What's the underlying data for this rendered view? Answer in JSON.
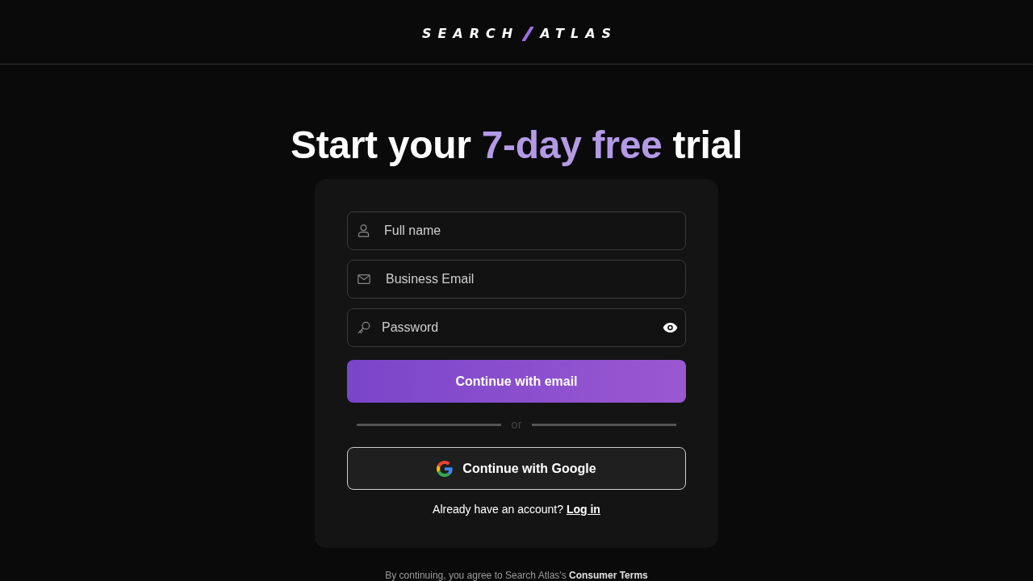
{
  "header": {
    "logo": {
      "left": "SEARCH",
      "right": "ATLAS"
    }
  },
  "heading": {
    "before": "Start your ",
    "highlight": "7-day free",
    "after": " trial"
  },
  "form": {
    "fields": [
      {
        "kind": "name",
        "placeholder": "Full name",
        "reveal_toggle": false
      },
      {
        "kind": "email",
        "placeholder": "Business Email",
        "reveal_toggle": false
      },
      {
        "kind": "password",
        "placeholder": "Password",
        "reveal_toggle": true
      }
    ],
    "primary_button": "Continue with email",
    "divider": "or",
    "google_button": "Continue with Google",
    "login_prompt": {
      "text": "Already have an account? ",
      "link": "Log in"
    }
  },
  "footer": {
    "text": "By continuing, you agree to Search Atlas's ",
    "link": "Consumer Terms"
  }
}
